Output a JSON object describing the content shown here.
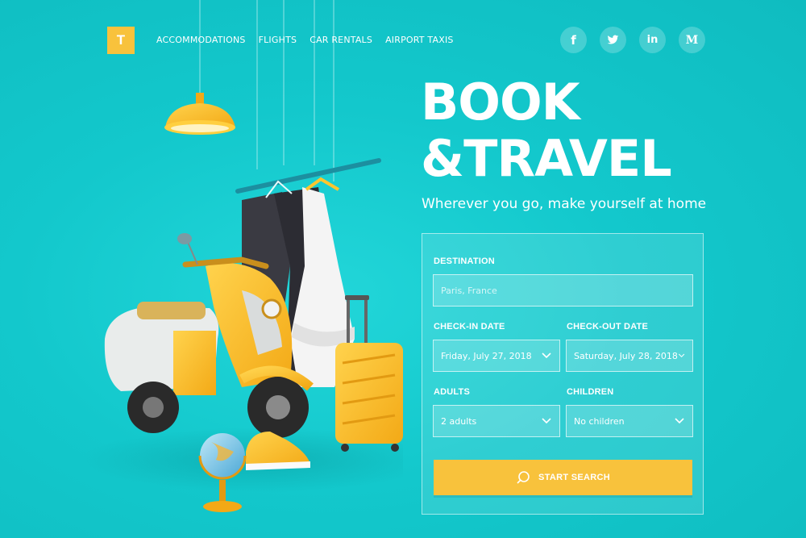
{
  "brand": {
    "logo_letter": "T"
  },
  "nav": {
    "items": [
      "ACCOMMODATIONS",
      "FLIGHTS",
      "CAR RENTALS",
      "AIRPORT TAXIS"
    ]
  },
  "social": {
    "facebook": "f",
    "twitter": "twitter-icon",
    "linkedin": "in",
    "medium": "M"
  },
  "hero": {
    "title_line1": "BOOK",
    "title_line2": "&TRAVEL",
    "subtitle": "Wherever you go, make yourself at home"
  },
  "form": {
    "destination_label": "DESTINATION",
    "destination_placeholder": "Paris, France",
    "checkin_label": "CHECK-IN DATE",
    "checkin_value": "Friday, July 27, 2018",
    "checkout_label": "CHECK-OUT DATE",
    "checkout_value": "Saturday, July 28, 2018",
    "adults_label": "ADULTS",
    "adults_value": "2 adults",
    "children_label": "CHILDREN",
    "children_value": "No children",
    "search_label": "START SEARCH"
  },
  "colors": {
    "background": "#13c8cc",
    "accent": "#f8c23c"
  }
}
